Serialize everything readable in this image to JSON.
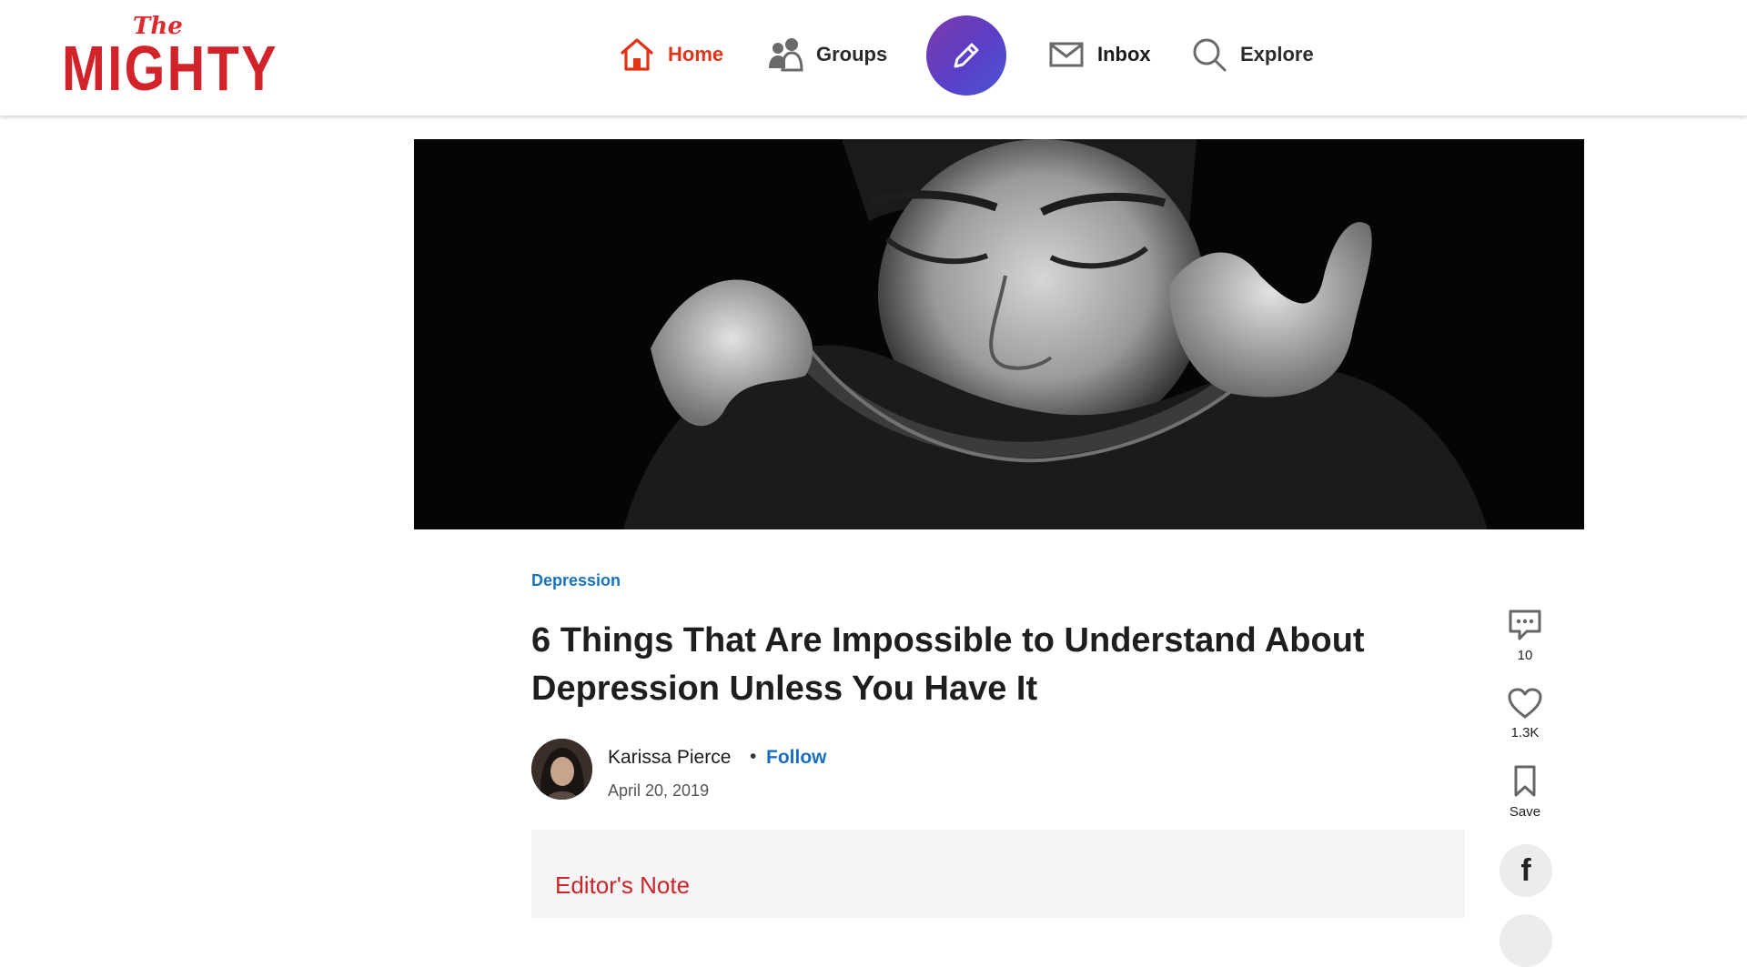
{
  "logo": {
    "the": "The",
    "name": "MIGHTY"
  },
  "nav": {
    "home": "Home",
    "groups": "Groups",
    "inbox": "Inbox",
    "explore": "Explore"
  },
  "article": {
    "category": "Depression",
    "title": "6 Things That Are Impossible to Understand About Depression Unless You Have It",
    "author": "Karissa Pierce",
    "separator": "•",
    "follow": "Follow",
    "date": "April 20, 2019",
    "editor_note_label": "Editor's Note"
  },
  "actions": {
    "comments_count": "10",
    "likes_count": "1.3K",
    "save_label": "Save",
    "share_glyph": "f"
  },
  "colors": {
    "accent_red": "#d2232a",
    "home_active": "#e33316",
    "link_blue": "#1a73b8",
    "compose_gradient_start": "#7b3aaa",
    "compose_gradient_end": "#4a56d6"
  }
}
